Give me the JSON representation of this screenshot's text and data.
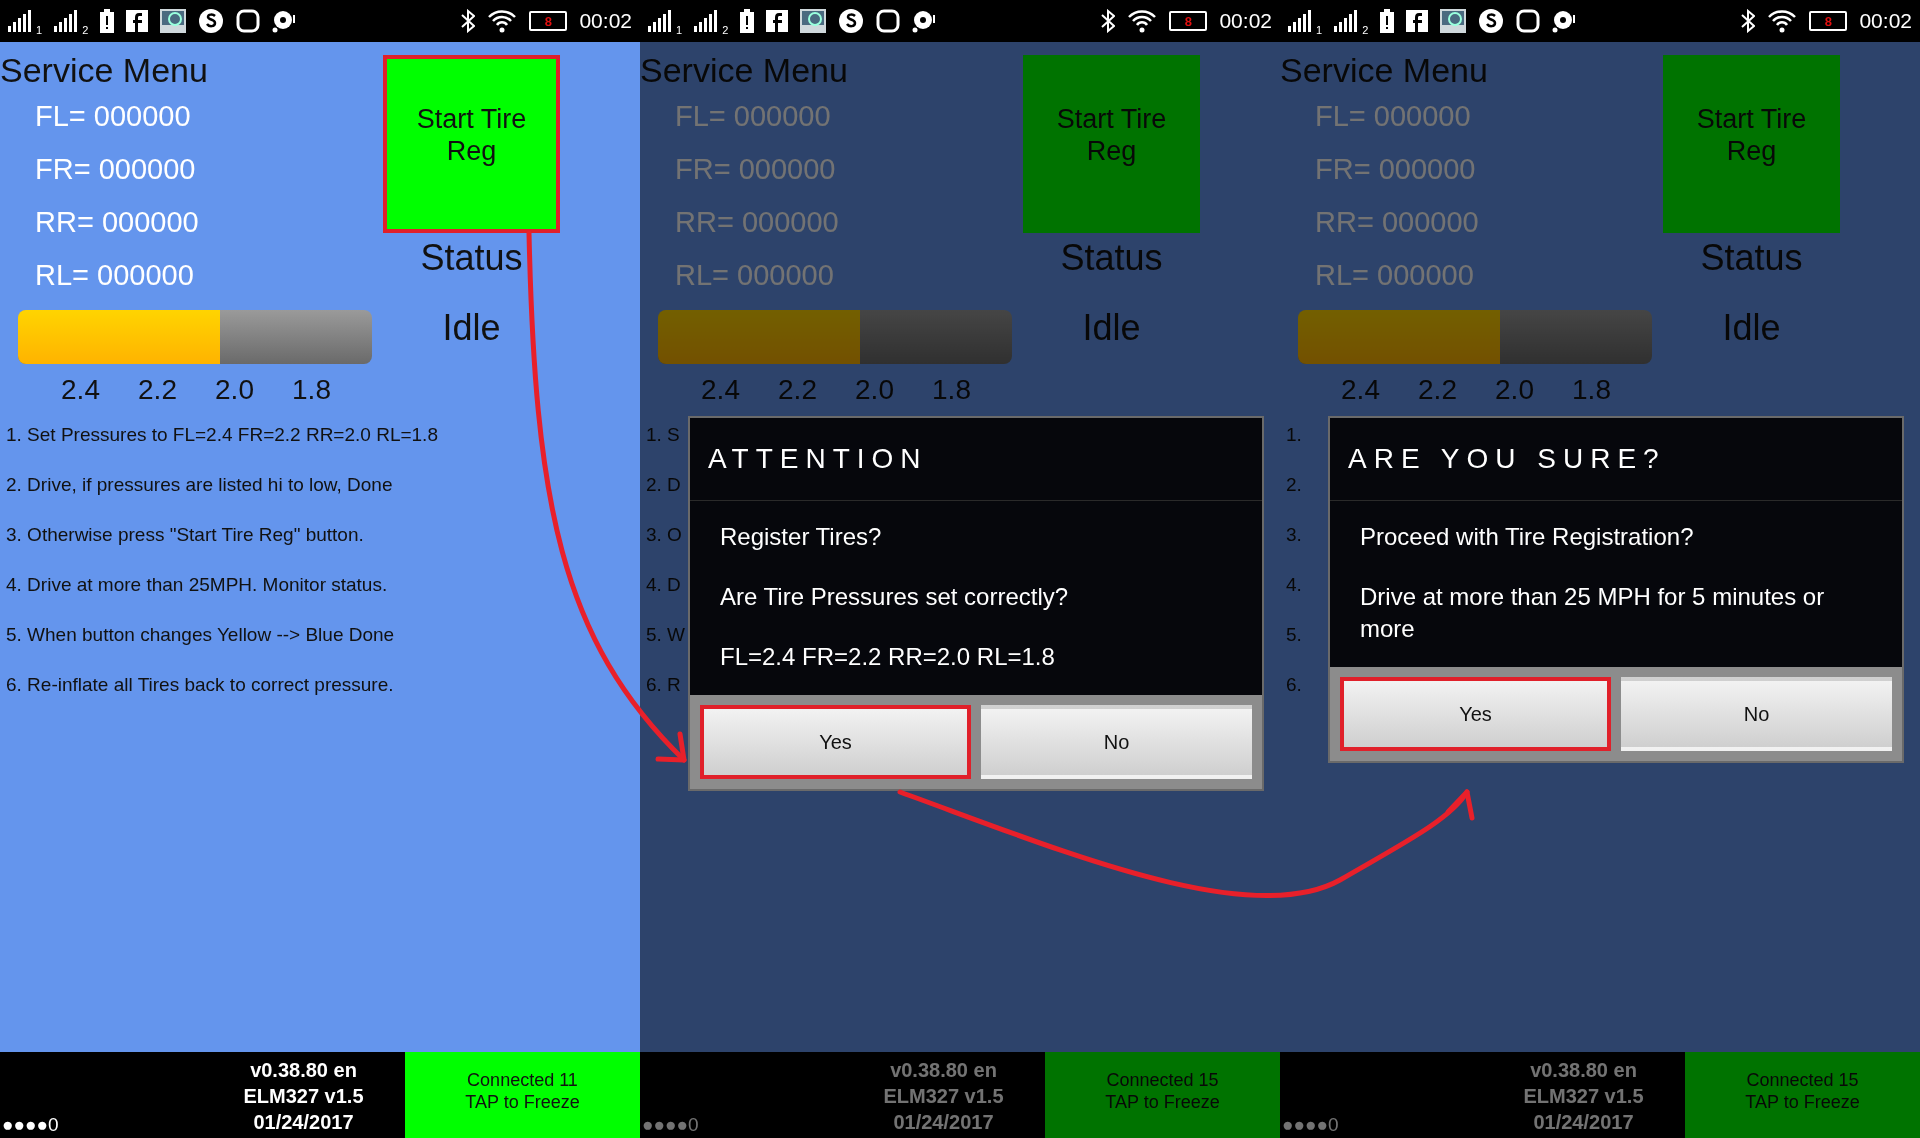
{
  "screens": [
    {
      "dimmed": false,
      "status_bar": {
        "sims": [
          "1",
          "2"
        ],
        "battery": "8",
        "time": "00:02"
      },
      "title": "Service Menu",
      "readings": [
        "FL= 000000",
        "FR= 000000",
        "RR= 000000",
        "RL= 000000"
      ],
      "start_button": {
        "label": "Start Tire Reg",
        "highlighted": true
      },
      "status_label": "Status",
      "status_value": "Idle",
      "pressure_bar": {
        "level": 0.57
      },
      "scale": [
        "2.4",
        "2.2",
        "2.0",
        "1.8"
      ],
      "instructions": [
        "1. Set Pressures to FL=2.4 FR=2.2  RR=2.0 RL=1.8",
        "2. Drive, if pressures are listed hi to low, Done",
        "3. Otherwise press \"Start Tire Reg\" button.",
        "4. Drive at more than 25MPH. Monitor status.",
        "5. When button changes Yellow --> Blue Done",
        "6. Re-inflate all Tires back to correct pressure."
      ],
      "footer": {
        "dots": "●●●●0",
        "version": [
          "v0.38.80 en",
          "ELM327 v1.5",
          "01/24/2017"
        ],
        "connection": [
          "Connected 11",
          "TAP to Freeze"
        ]
      }
    },
    {
      "dimmed": true,
      "status_bar": {
        "sims": [
          "1",
          "2"
        ],
        "battery": "8",
        "time": "00:02"
      },
      "title": "Service Menu",
      "readings": [
        "FL= 000000",
        "FR= 000000",
        "RR= 000000",
        "RL= 000000"
      ],
      "start_button": {
        "label": "Start Tire Reg",
        "highlighted": false
      },
      "status_label": "Status",
      "status_value": "Idle",
      "pressure_bar": {
        "level": 0.57
      },
      "scale": [
        "2.4",
        "2.2",
        "2.0",
        "1.8"
      ],
      "instructions": [
        "1. S",
        "2. D",
        "3. O",
        "4. D",
        "5. W",
        "6. R"
      ],
      "footer": {
        "dots": "●●●●0",
        "version": [
          "v0.38.80 en",
          "ELM327 v1.5",
          "01/24/2017"
        ],
        "connection": [
          "Connected 15",
          "TAP to Freeze"
        ]
      },
      "dialog": {
        "title": "ATTENTION",
        "messages": [
          "Register Tires?",
          "Are Tire Pressures set correctly?",
          "FL=2.4   FR=2.2   RR=2.0   RL=1.8"
        ],
        "buttons": [
          {
            "label": "Yes",
            "highlighted": true
          },
          {
            "label": "No",
            "highlighted": false
          }
        ]
      }
    },
    {
      "dimmed": true,
      "status_bar": {
        "sims": [
          "1",
          "2"
        ],
        "battery": "8",
        "time": "00:02"
      },
      "title": "Service Menu",
      "readings": [
        "FL= 000000",
        "FR= 000000",
        "RR= 000000",
        "RL= 000000"
      ],
      "start_button": {
        "label": "Start Tire Reg",
        "highlighted": false
      },
      "status_label": "Status",
      "status_value": "Idle",
      "pressure_bar": {
        "level": 0.57
      },
      "scale": [
        "2.4",
        "2.2",
        "2.0",
        "1.8"
      ],
      "instructions": [
        "1.",
        "2.",
        "3.",
        "4.",
        "5.",
        "6."
      ],
      "footer": {
        "dots": "●●●●0",
        "version": [
          "v0.38.80 en",
          "ELM327 v1.5",
          "01/24/2017"
        ],
        "connection": [
          "Connected 15",
          "TAP to Freeze"
        ]
      },
      "dialog": {
        "title": "ARE YOU SURE?",
        "messages": [
          "Proceed with Tire Registration?",
          "Drive at more than 25 MPH for 5 minutes or more"
        ],
        "buttons": [
          {
            "label": "Yes",
            "highlighted": true
          },
          {
            "label": "No",
            "highlighted": false
          }
        ]
      }
    }
  ]
}
